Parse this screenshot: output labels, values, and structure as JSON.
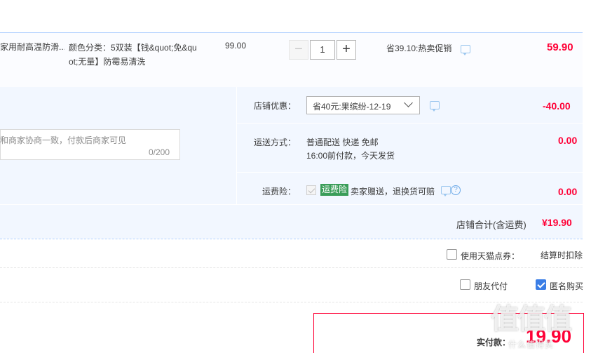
{
  "item": {
    "title": "家用耐高温防滑...",
    "sku": "颜色分类：5双装【钱&quot;免&quot;无量】防霉易清洗",
    "unit_price": "99.00",
    "qty_minus": "−",
    "quantity": "1",
    "qty_plus": "+",
    "promo": "省39.10:热卖促销",
    "total": "59.90"
  },
  "message": {
    "placeholder": "和商家协商一致，付款后商家可见",
    "count": "0/200"
  },
  "shop": {
    "discount_label": "店铺优惠：",
    "discount_value": "省40元:果缤纷-12-19",
    "discount_amount": "-40.00",
    "shipping_label": "运送方式：",
    "shipping_method": "普通配送 快递 免邮",
    "shipping_note": "16:00前付款，今天发货",
    "shipping_fee": "0.00",
    "insurance_label": "运费险：",
    "insurance_badge": "运费险",
    "insurance_text": "卖家赠送，退换货可赔",
    "insurance_help": "?",
    "insurance_fee": "0.00",
    "subtotal_label": "店铺合计(含运费)",
    "subtotal_value": "¥19.90"
  },
  "options": {
    "tmall_coupon_label": "使用天猫点券：",
    "tmall_coupon_note": "结算时扣除",
    "friend_pay_label": "朋友代付",
    "anonymous_label": "匿名购买"
  },
  "payment": {
    "label": "实付款：",
    "amount": "19.90"
  },
  "watermark": {
    "logo": "值值值",
    "site": "什么值得买"
  },
  "colors": {
    "price_red": "#ff0036",
    "accent_blue": "#3b7ee6",
    "insurance_green": "#3a9d59"
  }
}
